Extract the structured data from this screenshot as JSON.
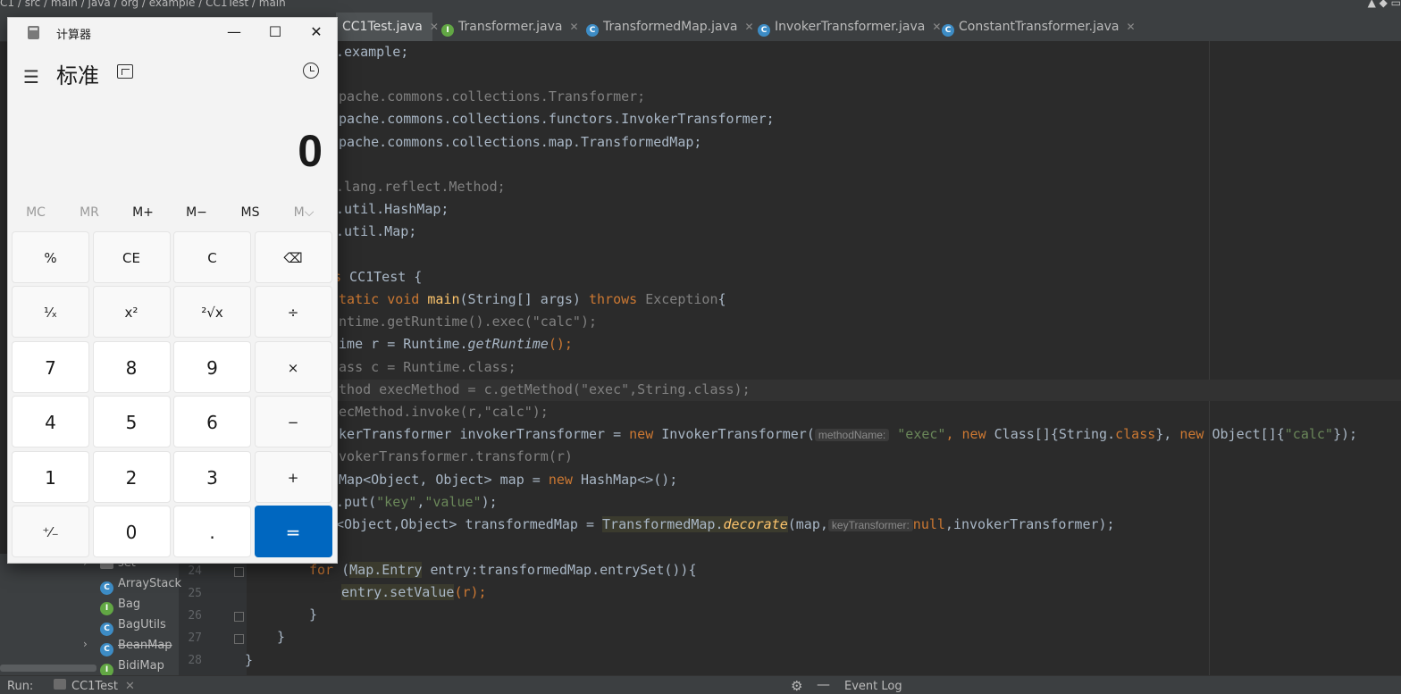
{
  "ide": {
    "breadcrumb": [
      "C1",
      "src",
      "main",
      "java",
      "org",
      "example",
      "CC1Test",
      "main"
    ],
    "tabs": [
      {
        "label": "CC1Test.java",
        "icon": "class-icon",
        "active": true
      },
      {
        "label": "Transformer.java",
        "icon": "interface-icon",
        "active": false
      },
      {
        "label": "TransformedMap.java",
        "icon": "class-icon",
        "active": false
      },
      {
        "label": "InvokerTransformer.java",
        "icon": "class-icon",
        "active": false
      },
      {
        "label": "ConstantTransformer.java",
        "icon": "class-icon",
        "active": false
      }
    ],
    "tab_close": "✕",
    "line_numbers": [
      "24",
      "25",
      "26",
      "27",
      "28"
    ],
    "code": {
      "l1": ".example;",
      "l2": "apache.commons.collections.Transformer;",
      "l3": "apache.commons.collections.functors.InvokerTransformer;",
      "l4": "apache.commons.collections.map.TransformedMap;",
      "l5": ".lang.reflect.Method;",
      "l6": ".util.HashMap;",
      "l7": ".util.Map;",
      "l8a": "s",
      "l8b": " CC1Test {",
      "l9a": "static void ",
      "l9b": "main",
      "l9c": "(String[] args) ",
      "l9d": "throws",
      "l9e": " Exception",
      "l9f": "{",
      "l10": "untime.getRuntime().exec(\"calc\");",
      "l11a": "time r = Runtime.",
      "l11b": "getRuntime",
      "l11c": "();",
      "l12": "lass c = Runtime.class;",
      "l13": "ethod execMethod = c.getMethod(\"exec\",String.class);",
      "l14": "xecMethod.invoke(r,\"calc\");",
      "l15a": "okerTransformer invokerTransformer = ",
      "l15b": "new",
      "l15c": " InvokerTransformer(",
      "l15hint": "methodName:",
      "l15d": "\"exec\"",
      "l15e": ", ",
      "l15f": "new",
      "l15g": " Class[]{String.",
      "l15h": "class",
      "l15i": "}, ",
      "l15j": "new",
      "l15k": " Object[]{",
      "l15l": "\"calc\"",
      "l15m": "});",
      "l16": "nvokerTransformer.transform(r)",
      "l17a": "hMap<Object, Object> map = ",
      "l17b": "new",
      "l17c": " HashMap<>();",
      "l18a": ".put(",
      "l18b": "\"key\"",
      "l18c": ",",
      "l18d": "\"value\"",
      "l18e": ");",
      "l19a": "<Object,Object> transformedMap = ",
      "l19b": "TransformedMap.",
      "l19c": "decorate",
      "l19d": "(map,",
      "l19hint": "keyTransformer:",
      "l19e": "null",
      "l19f": ",invokerTransformer);",
      "l24a": "for",
      "l24b": " (",
      "l24c": "Map.Entry",
      "l24d": " entry:transformedMap.entrySet()){",
      "l25a": "entry.setValue",
      "l25b": "(r);",
      "l26": "}",
      "l27": "}",
      "l28": "}"
    },
    "tree": [
      {
        "label": "set",
        "icon": "folder-icon",
        "strike": false
      },
      {
        "label": "ArrayStack",
        "icon": "class-icon",
        "strike": false
      },
      {
        "label": "Bag",
        "icon": "interface-icon",
        "strike": false
      },
      {
        "label": "BagUtils",
        "icon": "class-icon",
        "strike": false
      },
      {
        "label": "BeanMap",
        "icon": "class-icon",
        "strike": true
      },
      {
        "label": "BidiMap",
        "icon": "interface-icon",
        "strike": false
      }
    ],
    "status": {
      "run_label": "Run:",
      "run_config": "CC1Test",
      "event_log": "Event Log"
    }
  },
  "calculator": {
    "title": "计算器",
    "mode": "标准",
    "display": "0",
    "memory": [
      {
        "label": "MC",
        "enabled": false
      },
      {
        "label": "MR",
        "enabled": false
      },
      {
        "label": "M+",
        "enabled": true
      },
      {
        "label": "M−",
        "enabled": true
      },
      {
        "label": "MS",
        "enabled": true
      },
      {
        "label": "M⌵",
        "enabled": false
      }
    ],
    "keys": [
      [
        "%",
        "CE",
        "C",
        "⌫"
      ],
      [
        "¹⁄ₓ",
        "x²",
        "²√x",
        "÷"
      ],
      [
        "7",
        "8",
        "9",
        "×"
      ],
      [
        "4",
        "5",
        "6",
        "−"
      ],
      [
        "1",
        "2",
        "3",
        "+"
      ],
      [
        "⁺⁄₋",
        "0",
        ".",
        "="
      ]
    ],
    "accent": "#0067c0"
  }
}
